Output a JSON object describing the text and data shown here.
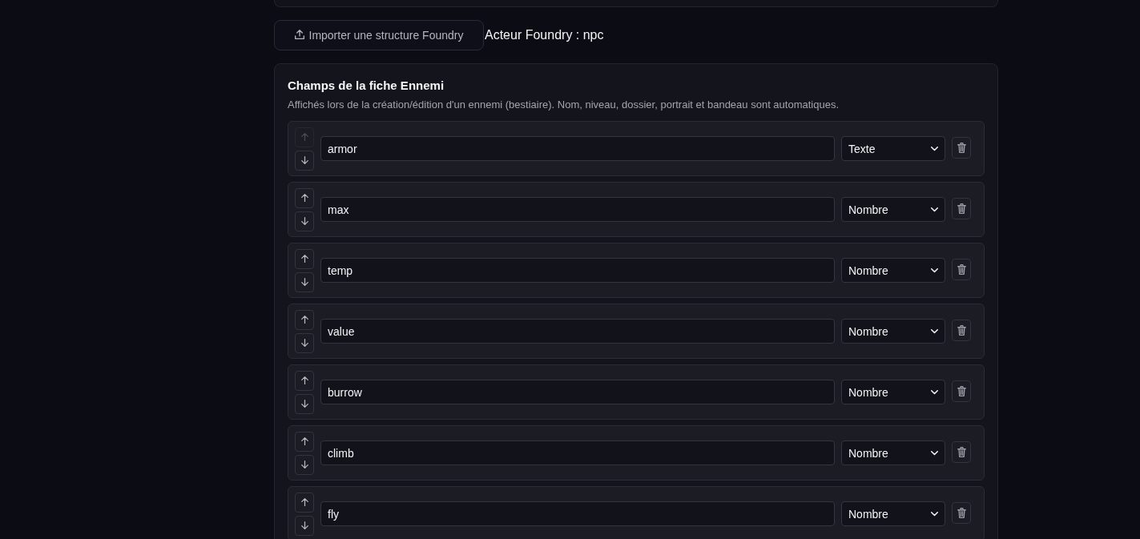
{
  "toolbar": {
    "import_button": "Importer une structure Foundry",
    "actor_label": "Acteur Foundry : npc"
  },
  "card": {
    "title": "Champs de la fiche Ennemi",
    "description": "Affichés lors de la création/édition d'un ennemi (bestiaire). Nom, niveau, dossier, portrait et bandeau sont automatiques.",
    "fields": [
      {
        "name": "armor",
        "type": "Texte",
        "up_disabled": true,
        "down_disabled": false
      },
      {
        "name": "max",
        "type": "Nombre",
        "up_disabled": false,
        "down_disabled": false
      },
      {
        "name": "temp",
        "type": "Nombre",
        "up_disabled": false,
        "down_disabled": false
      },
      {
        "name": "value",
        "type": "Nombre",
        "up_disabled": false,
        "down_disabled": false
      },
      {
        "name": "burrow",
        "type": "Nombre",
        "up_disabled": false,
        "down_disabled": false
      },
      {
        "name": "climb",
        "type": "Nombre",
        "up_disabled": false,
        "down_disabled": false
      },
      {
        "name": "fly",
        "type": "Nombre",
        "up_disabled": false,
        "down_disabled": false
      }
    ]
  }
}
